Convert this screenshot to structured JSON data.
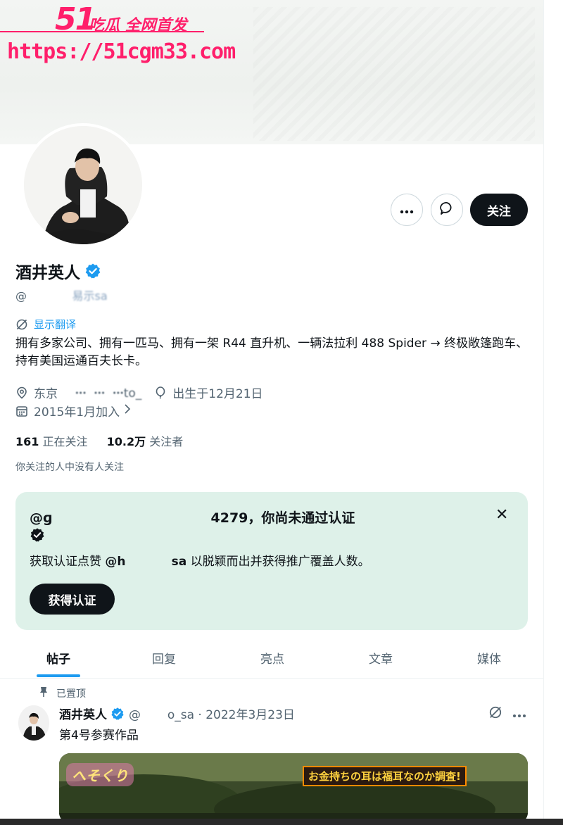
{
  "watermark": {
    "logo": "51",
    "slogan": "吃瓜 全网首发",
    "url": "https://51cgm33.com"
  },
  "actions": {
    "more_icon": "more-dots-icon",
    "message_icon": "message-bubble-icon",
    "follow_label": "关注"
  },
  "profile": {
    "name": "酒井英人",
    "handle_prefix": "@",
    "handle_visible": "      易示sa",
    "translate_label": "显示翻译",
    "bio": "拥有多家公司、拥有一匹马、拥有一架 R44 直升机、一辆法拉利 488 Spider → 终极敞篷跑车、持有美国运通百夫长卡。",
    "location": "东京",
    "website": "  ꞏꞏꞏ  ꞏꞏꞏ  ꞏꞏꞏto_",
    "birthday": "出生于12月21日",
    "joined": "2015年1月加入",
    "following_count": "161",
    "following_label": "正在关注",
    "followers_count": "10.2万",
    "followers_label": "关注者",
    "followed_by_note": "你关注的人中没有人关注"
  },
  "verify_card": {
    "title": "@ɡ                                  4279，你尚未通过认证",
    "desc_prefix": "获取认证点赞",
    "desc_handle": "@h           sa",
    "desc_suffix": "以脱颖而出并获得推广覆盖人数。",
    "button": "获得认证",
    "close": "✕"
  },
  "tabs": [
    "帖子",
    "回复",
    "亮点",
    "文章",
    "媒体"
  ],
  "post": {
    "pinned_label": "已置顶",
    "author": "酒井英人",
    "handle_date": "@       o_sa · 2022年3月23日",
    "text": "第4号参赛作品",
    "media_caption": "お金持ちの耳は福耳なのか調査!",
    "media_logo": "へそくり"
  },
  "colors": {
    "accent": "#1d9bf0",
    "watermark": "#ff1f6b",
    "card_bg": "#def1e9",
    "dark": "#0f1419"
  }
}
